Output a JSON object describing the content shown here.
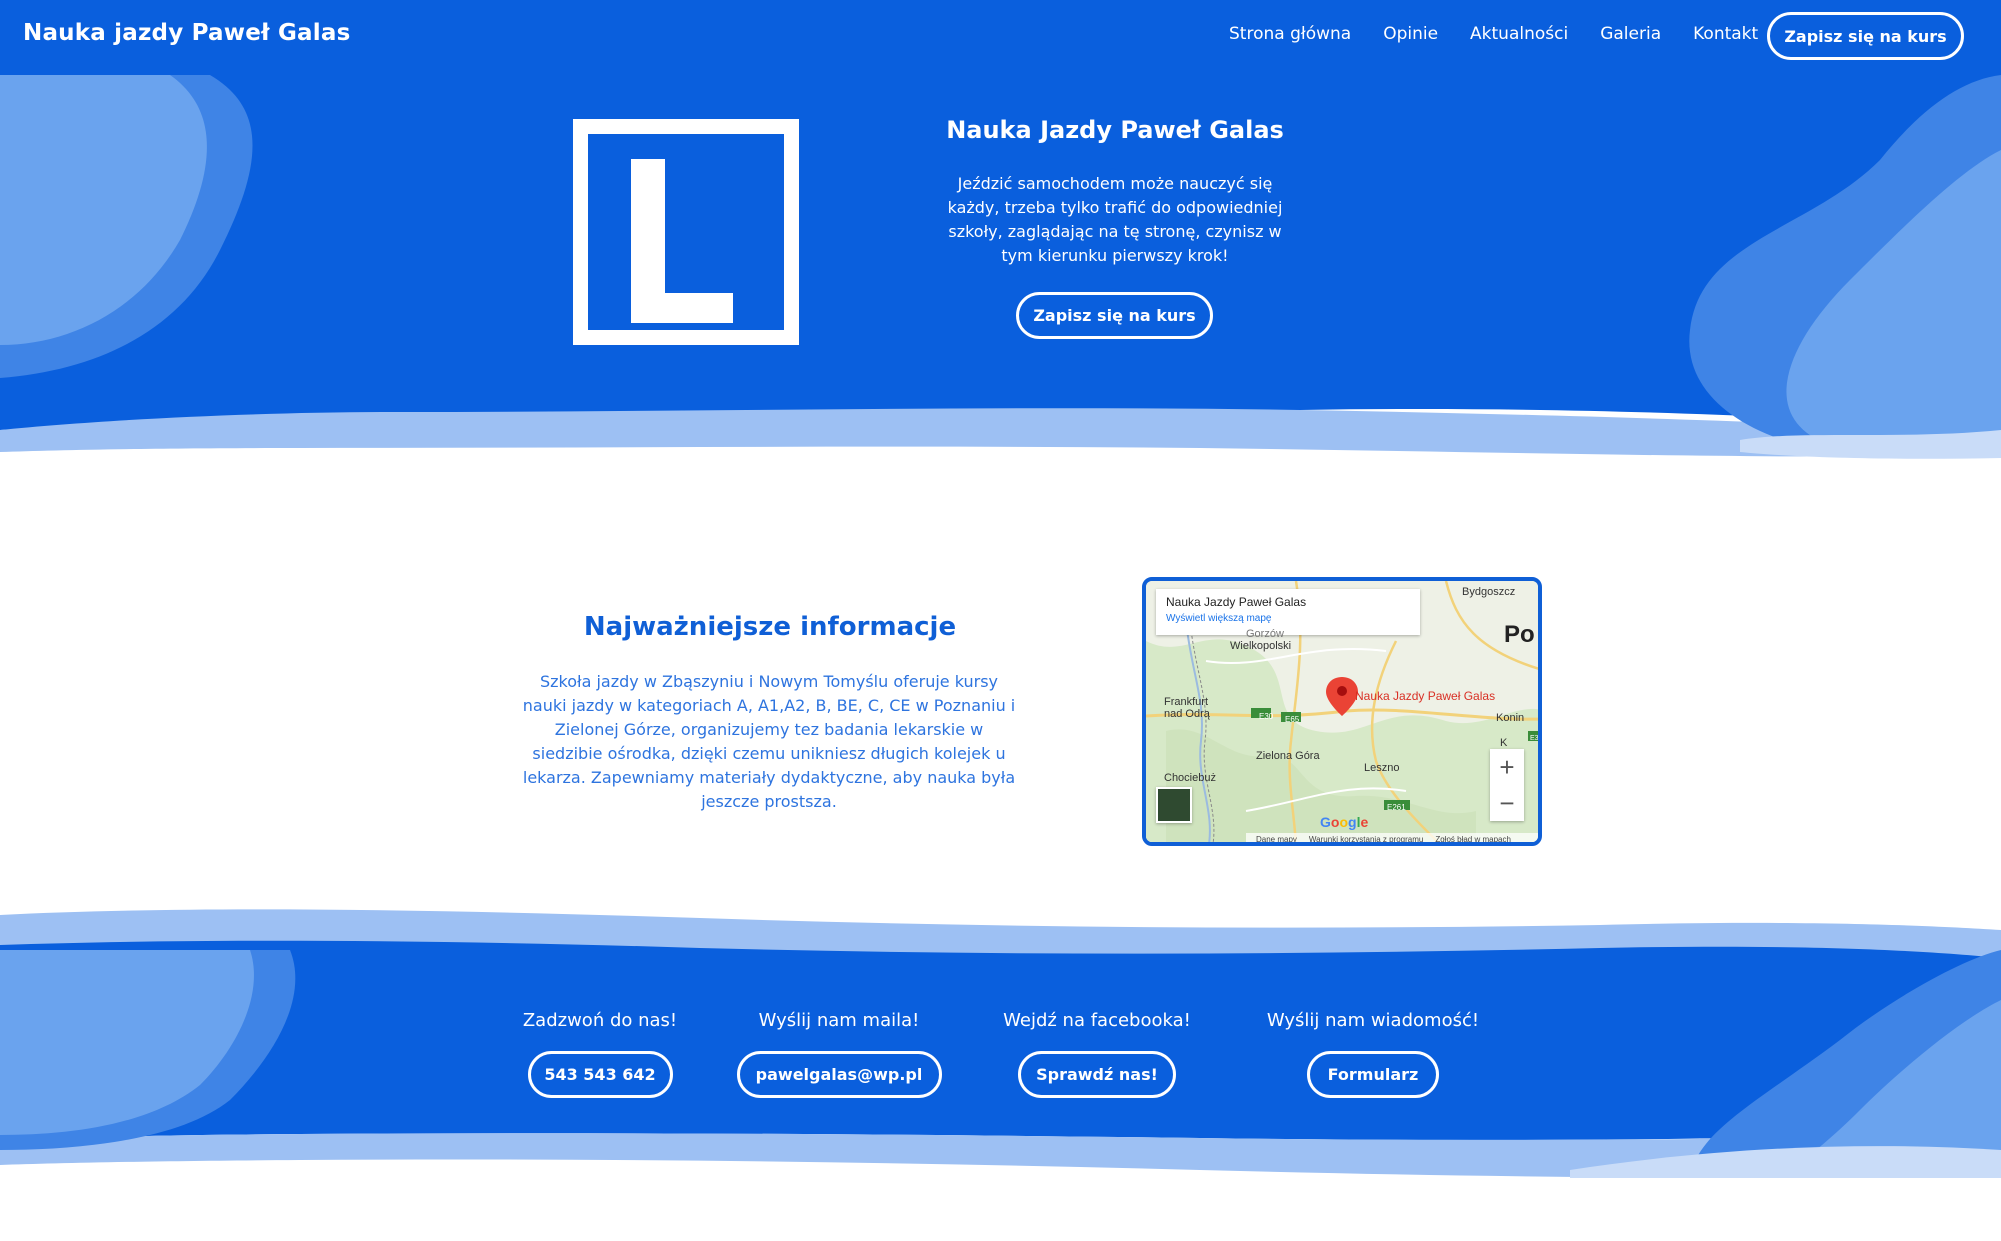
{
  "nav": {
    "brand": "Nauka jazdy Paweł Galas",
    "items": [
      "Strona główna",
      "Opinie",
      "Aktualności",
      "Galeria",
      "Kontakt"
    ],
    "cta": "Zapisz się na kurs"
  },
  "hero": {
    "logo_letter": "L",
    "title": "Nauka Jazdy Paweł Galas",
    "text": "Jeździć samochodem może nauczyć się każdy, trzeba tylko trafić do odpowiedniej szkoły, zaglądając na tę stronę, czynisz w tym kierunku pierwszy krok!",
    "cta": "Zapisz się na kurs"
  },
  "info": {
    "title": "Najważniejsze informacje",
    "text": "Szkoła jazdy w Zbąszyniu i Nowym Tomyślu oferuje kursy nauki jazdy w kategoriach A, A1,A2, B, BE, C, CE w Poznaniu i Zielonej Górze, organizujemy tez badania lekarskie w siedzibie ośrodka, dzięki czemu unikniesz długich kolejek u lekarza. Zapewniamy materiały dydaktyczne, aby nauka była jeszcze prostsza."
  },
  "map": {
    "place": "Nauka Jazdy Paweł Galas",
    "link": "Wyświetl większą mapę",
    "pin_label": "Nauka Jazdy Paweł Galas",
    "big_label": "Po",
    "cities": {
      "bydgoszcz": "Bydgoszcz",
      "gorzow1": "Gorzów",
      "gorzow2": "Wielkopolski",
      "frankfurt1": "Frankfurt",
      "frankfurt2": "nad Odrą",
      "konin": "Konin",
      "zielona": "Zielona Góra",
      "leszno": "Leszno",
      "chociebuz": "Chociebuż",
      "k1": "K",
      "k2": "K"
    },
    "roads": {
      "e30a": "E30",
      "e65": "E65",
      "e30b": "E30",
      "e261": "E261"
    },
    "zoom_in": "+",
    "zoom_out": "−",
    "google": "Google",
    "footer": [
      "Dane mapy",
      "Warunki korzystania z programu",
      "Zgłoś błąd w mapach"
    ]
  },
  "contact": [
    {
      "question": "Zadzwoń do nas!",
      "button": "543 543 642"
    },
    {
      "question": "Wyślij nam maila!",
      "button": "pawelgalas@wp.pl"
    },
    {
      "question": "Wejdź na facebooka!",
      "button": "Sprawdź nas!"
    },
    {
      "question": "Wyślij nam wiadomość!",
      "button": "Formularz"
    }
  ],
  "colors": {
    "primary": "#0a5fdd",
    "light": "#9dc0f3",
    "blob": "#5f9be9"
  }
}
